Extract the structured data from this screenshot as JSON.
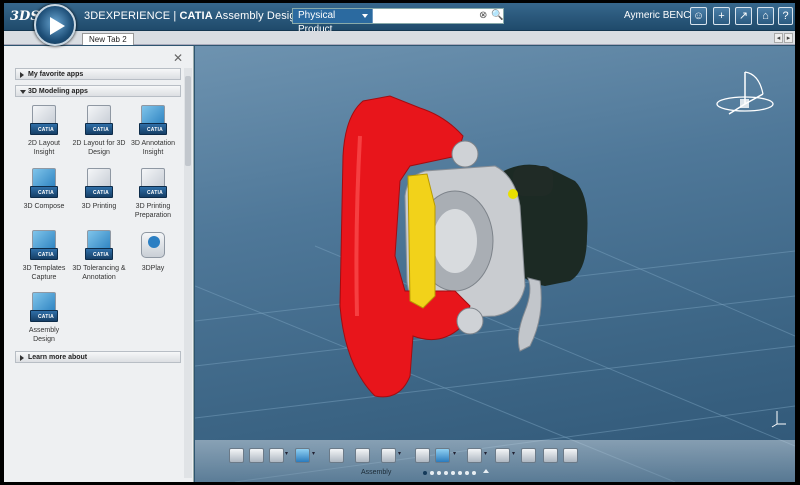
{
  "header": {
    "logo": "3DS",
    "brand_prefix": "3DEXPERIENCE | ",
    "brand_app": "CATIA",
    "brand_suffix": " Assembly Design",
    "search_scope": "Physical Product",
    "search_value": "",
    "user_name": "Aymeric BENCE",
    "buttons": [
      {
        "icon": "user-icon",
        "glyph": "☺"
      },
      {
        "icon": "plus-icon",
        "glyph": "+"
      },
      {
        "icon": "share-icon",
        "glyph": "↗"
      },
      {
        "icon": "home-icon",
        "glyph": "⌂"
      },
      {
        "icon": "help-icon",
        "glyph": "?"
      }
    ]
  },
  "tabs": [
    {
      "label": "New Tab 2"
    }
  ],
  "panel": {
    "favorites_label": "My favorite apps",
    "modeling_label": "3D Modeling apps",
    "learn_more_label": "Learn more about",
    "apps": [
      {
        "label": "2D Layout Insight",
        "badge": "CATIA"
      },
      {
        "label": "2D Layout for 3D Design",
        "badge": "CATIA"
      },
      {
        "label": "3D Annotation Insight",
        "badge": "CATIA"
      },
      {
        "label": "3D Compose",
        "badge": "CATIA"
      },
      {
        "label": "3D Printing",
        "badge": "CATIA"
      },
      {
        "label": "3D Printing Preparation",
        "badge": "CATIA"
      },
      {
        "label": "3D Templates Capture",
        "badge": "CATIA"
      },
      {
        "label": "3D Tolerancing & Annotation",
        "badge": "CATIA"
      },
      {
        "label": "3DPlay",
        "badge": ""
      },
      {
        "label": "Assembly Design",
        "badge": "CATIA"
      }
    ]
  },
  "toolbar": {
    "label": "Assembly",
    "page_count": 8,
    "active_page": 1
  },
  "colors": {
    "caliper": "#e8151b",
    "brake_pad": "#f2d21a",
    "housing": "#c9ccd0",
    "boot": "#1c2a24"
  }
}
